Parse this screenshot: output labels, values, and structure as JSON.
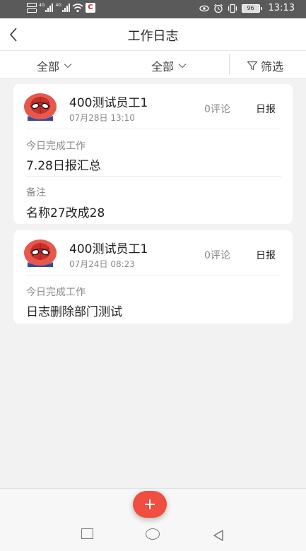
{
  "status_bar": {
    "network_1": "4G",
    "network_2": "4G",
    "app_badge": "C",
    "battery": "96",
    "time": "13:13"
  },
  "header": {
    "title": "工作日志"
  },
  "filters": {
    "dropdown_1": "全部",
    "dropdown_2": "全部",
    "filter_label": "筛选"
  },
  "logs": [
    {
      "author": "400测试员工1",
      "datetime": "07月28日 13:10",
      "comments": "0评论",
      "type": "日报",
      "work_label": "今日完成工作",
      "work": "7.28日报汇总",
      "remark_label": "备注",
      "remark": "名称27改成28"
    },
    {
      "author": "400测试员工1",
      "datetime": "07月24日 08:23",
      "comments": "0评论",
      "type": "日报",
      "work_label": "今日完成工作",
      "work": "日志删除部门测试"
    }
  ],
  "colors": {
    "accent": "#f04e40",
    "background": "#f2f2f2"
  },
  "icons": {
    "back": "chevron-left-icon",
    "dropdown": "chevron-down-icon",
    "filter": "funnel-icon",
    "add": "plus-icon"
  }
}
